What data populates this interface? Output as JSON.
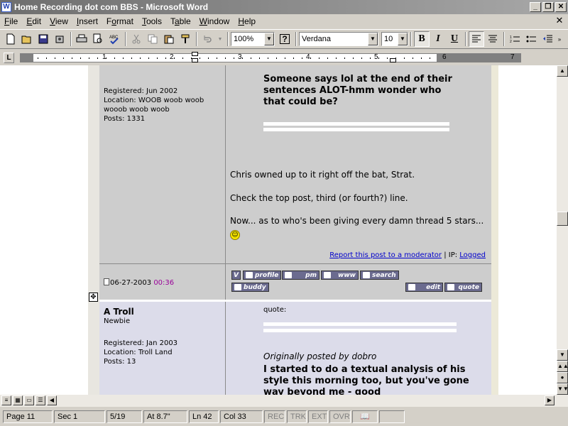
{
  "window": {
    "title": "Home Recording dot com BBS - Microsoft Word",
    "app_icon": "W",
    "buttons": {
      "minimize": "_",
      "restore": "❐",
      "close": "✕"
    }
  },
  "menu": [
    {
      "label": "File",
      "key": "F"
    },
    {
      "label": "Edit",
      "key": "E"
    },
    {
      "label": "View",
      "key": "V"
    },
    {
      "label": "Insert",
      "key": "I"
    },
    {
      "label": "Format",
      "key": "o"
    },
    {
      "label": "Tools",
      "key": "T"
    },
    {
      "label": "Table",
      "key": "a"
    },
    {
      "label": "Window",
      "key": "W"
    },
    {
      "label": "Help",
      "key": "H"
    }
  ],
  "toolbar": {
    "zoom": "100%",
    "font": "Verdana",
    "size": "10",
    "bold": "B",
    "italic": "I",
    "underline": "U",
    "help_symbol": "?",
    "icons": [
      "new-icon",
      "open-icon",
      "save-icon",
      "permission-icon",
      "print-icon",
      "print-preview-icon",
      "spelling-icon",
      "cut-icon",
      "copy-icon",
      "paste-icon",
      "format-painter-icon",
      "undo-icon",
      "redo-icon",
      "help-icon"
    ]
  },
  "ruler": {
    "tab_marker": "L",
    "numbers": [
      "1",
      "2",
      "3",
      "4",
      "5",
      "6",
      "7"
    ]
  },
  "posts": [
    {
      "author_meta": {
        "registered": "Registered: Jun 2002",
        "location": "Location: WOOB woob woob wooob woob woob",
        "posts": "Posts: 1331"
      },
      "quoted_bold": "Someone says lol at the end of their sentences ALOT-hmm wonder who that could be?",
      "paragraphs": [
        "Chris owned up to it right off the bat, Strat.",
        "Check the top post, third (or fourth?) line.",
        "Now... as to who's been giving every damn thread 5 stars..."
      ],
      "report_link": "Report this post to a moderator",
      "ip_label": " | IP: ",
      "ip_link": "Logged",
      "date": "06-27-2003",
      "time": "00:36",
      "buttons": {
        "v": "V",
        "profile": "profile",
        "pm": "pm",
        "www": "www",
        "search": "search",
        "buddy": "buddy",
        "edit": "edit",
        "quote": "quote"
      }
    },
    {
      "author": "A Troll",
      "rank": "Newbie",
      "author_meta": {
        "registered": "Registered: Jan 2003",
        "location": "Location: Troll Land",
        "posts": "Posts: 13"
      },
      "quote_label": "quote:",
      "orig_posted": "Originally posted by dobro",
      "quoted_bold": "I started to do a textual analysis of his style this morning too, but you've gone way beyond me - good"
    }
  ],
  "statusbar": {
    "page": "Page 11",
    "sec": "Sec 1",
    "pages": "5/19",
    "at": "At 8.7\"",
    "ln": "Ln 42",
    "col": "Col 33",
    "rec": "REC",
    "trk": "TRK",
    "ext": "EXT",
    "ovr": "OVR"
  }
}
